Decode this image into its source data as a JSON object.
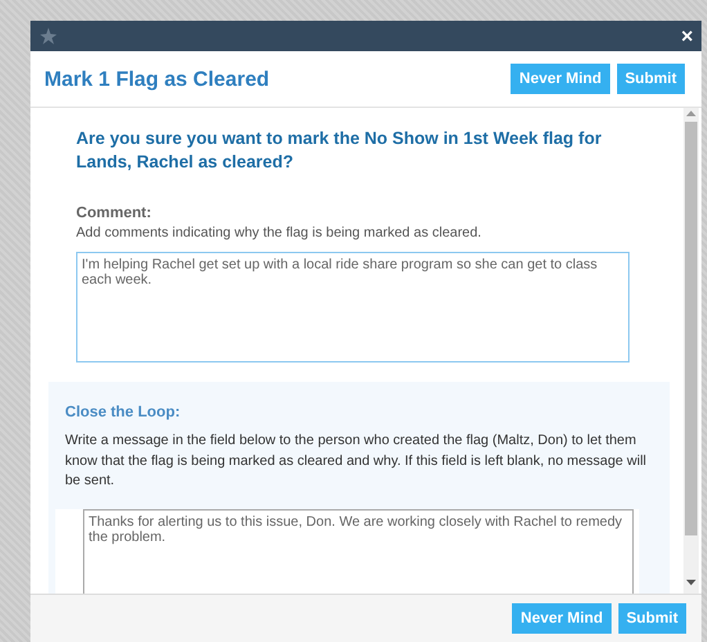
{
  "dialog": {
    "close_icon": "×",
    "title": "Mark 1 Flag as Cleared",
    "header_buttons": [
      "Never Mind",
      "Submit"
    ],
    "question": "Are you sure you want to mark the No Show in 1st Week flag for Lands, Rachel as cleared?",
    "comment": {
      "label": "Comment:",
      "help": "Add comments indicating why the flag is being marked as cleared.",
      "value": "I'm helping Rachel get set up with a local ride share program so she can get to class each week."
    },
    "close_the_loop": {
      "label": "Close the Loop:",
      "help": "Write a message in the field below to the person who created the flag (Maltz, Don) to let them know that the flag is being marked as cleared and why. If this field is left blank, no message will be sent.",
      "value": "Thanks for alerting us to this issue, Don. We are working closely with Rachel to remedy the problem."
    },
    "footer_buttons": [
      "Never Mind",
      "Submit"
    ]
  }
}
